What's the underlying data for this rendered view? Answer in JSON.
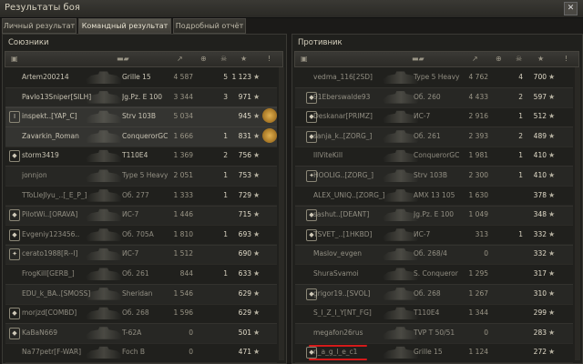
{
  "window": {
    "title": "Результаты боя"
  },
  "tabs": [
    "Личный результат",
    "Командный результат",
    "Подробный отчёт"
  ],
  "allies": {
    "title": "Союзники",
    "rows": [
      {
        "player": "Artem200214",
        "vehicle": "Grille 15",
        "damage": "4 587",
        "frags": "5",
        "xp": "1 123",
        "platoon": "",
        "dead": false,
        "medal": false
      },
      {
        "player": "Pavlo13Sniper[SILH]",
        "vehicle": "Jg.Pz. E 100",
        "damage": "3 344",
        "frags": "3",
        "xp": "971",
        "platoon": "",
        "dead": false,
        "medal": false
      },
      {
        "player": "inspekt..[YAP_C]",
        "vehicle": "Strv 103B",
        "damage": "5 034",
        "frags": "",
        "xp": "945",
        "platoon": "I",
        "dead": false,
        "medal": true
      },
      {
        "player": "Zavarkin_Roman",
        "vehicle": "ConquerorGC",
        "damage": "1 666",
        "frags": "1",
        "xp": "831",
        "platoon": "",
        "dead": false,
        "medal": true
      },
      {
        "player": "storm3419",
        "vehicle": "T110E4",
        "damage": "1 369",
        "frags": "2",
        "xp": "756",
        "platoon": "◆",
        "dead": false,
        "medal": false
      },
      {
        "player": "jonnjon",
        "vehicle": "Type 5 Heavy",
        "damage": "2 051",
        "frags": "1",
        "xp": "753",
        "platoon": "",
        "dead": true,
        "medal": false
      },
      {
        "player": "TToLleJlyu_..[_E_P_]",
        "vehicle": "Об. 277",
        "damage": "1 333",
        "frags": "1",
        "xp": "729",
        "platoon": "",
        "dead": true,
        "medal": false
      },
      {
        "player": "PilotWi..[ORAVA]",
        "vehicle": "ИС-7",
        "damage": "1 446",
        "frags": "",
        "xp": "715",
        "platoon": "◆",
        "dead": true,
        "medal": false
      },
      {
        "player": "Evgeniy123456..",
        "vehicle": "Об. 705A",
        "damage": "1 810",
        "frags": "1",
        "xp": "693",
        "platoon": "◆",
        "dead": true,
        "medal": false
      },
      {
        "player": "cerato1988[R--I]",
        "vehicle": "ИС-7",
        "damage": "1 512",
        "frags": "",
        "xp": "690",
        "platoon": "✦",
        "dead": true,
        "medal": false
      },
      {
        "player": "FrogKill[GERB_]",
        "vehicle": "Об. 261",
        "damage": "844",
        "frags": "1",
        "xp": "633",
        "platoon": "",
        "dead": true,
        "medal": false
      },
      {
        "player": "EDU_k_BA..[SMOSS]",
        "vehicle": "Sheridan",
        "damage": "1 546",
        "frags": "",
        "xp": "629",
        "platoon": "",
        "dead": true,
        "medal": false
      },
      {
        "player": "morjzd[COMBD]",
        "vehicle": "Об. 268",
        "damage": "1 596",
        "frags": "",
        "xp": "629",
        "platoon": "◆",
        "dead": true,
        "medal": false
      },
      {
        "player": "KaBaN669",
        "vehicle": "T-62A",
        "damage": "0",
        "frags": "",
        "xp": "501",
        "platoon": "◆",
        "dead": true,
        "medal": false
      },
      {
        "player": "Na77petr[F-WAR]",
        "vehicle": "Foch B",
        "damage": "0",
        "frags": "",
        "xp": "471",
        "platoon": "",
        "dead": true,
        "medal": false
      }
    ]
  },
  "enemies": {
    "title": "Противник",
    "rows": [
      {
        "player": "vedma_116[2SD]",
        "vehicle": "Type 5 Heavy",
        "damage": "4 762",
        "frags": "4",
        "xp": "700",
        "platoon": "",
        "dead": true
      },
      {
        "player": "91Eberswalde93",
        "vehicle": "Об. 260",
        "damage": "4 433",
        "frags": "2",
        "xp": "597",
        "platoon": "◆",
        "dead": true
      },
      {
        "player": "Deskanar[PRIMZ]",
        "vehicle": "ИС-7",
        "damage": "2 916",
        "frags": "1",
        "xp": "512",
        "platoon": "◆",
        "dead": true
      },
      {
        "player": "sanja_k..[ZORG_]",
        "vehicle": "Об. 261",
        "damage": "2 393",
        "frags": "2",
        "xp": "489",
        "platoon": "◆",
        "dead": true
      },
      {
        "player": "lllViteKill",
        "vehicle": "ConquerorGC",
        "damage": "1 981",
        "frags": "1",
        "xp": "410",
        "platoon": "",
        "dead": true
      },
      {
        "player": "HOOLIG..[ZORG_]",
        "vehicle": "Strv 103B",
        "damage": "2 300",
        "frags": "1",
        "xp": "410",
        "platoon": "✦",
        "dead": true
      },
      {
        "player": "ALEX_UNIQ..[ZORG_]",
        "vehicle": "AMX 13 105",
        "damage": "1 630",
        "frags": "",
        "xp": "378",
        "platoon": "",
        "dead": true
      },
      {
        "player": "sashut..[DEANT]",
        "vehicle": "Jg.Pz. E 100",
        "damage": "1 049",
        "frags": "",
        "xp": "348",
        "platoon": "◆",
        "dead": true
      },
      {
        "player": "TSVET_..[1HKBD]",
        "vehicle": "ИС-7",
        "damage": "313",
        "frags": "1",
        "xp": "332",
        "platoon": "◆",
        "dead": true
      },
      {
        "player": "Maslov_evgen",
        "vehicle": "Об. 268/4",
        "damage": "0",
        "frags": "",
        "xp": "332",
        "platoon": "",
        "dead": true
      },
      {
        "player": "ShuraSvamoi",
        "vehicle": "S. Conqueror",
        "damage": "1 295",
        "frags": "",
        "xp": "317",
        "platoon": "",
        "dead": true
      },
      {
        "player": "grigor19..[SVOL]",
        "vehicle": "Об. 268",
        "damage": "1 267",
        "frags": "",
        "xp": "310",
        "platoon": "◆",
        "dead": true
      },
      {
        "player": "S_I_Z_I_Y[NT_FG]",
        "vehicle": "T110E4",
        "damage": "1 344",
        "frags": "",
        "xp": "299",
        "platoon": "",
        "dead": true
      },
      {
        "player": "megafon26rus",
        "vehicle": "TVP T 50/51",
        "damage": "0",
        "frags": "",
        "xp": "283",
        "platoon": "",
        "dead": true
      },
      {
        "player": "n_a_g_l_e_c1",
        "vehicle": "Grille 15",
        "damage": "1 124",
        "frags": "",
        "xp": "272",
        "platoon": "◆",
        "dead": true
      }
    ]
  },
  "colors": {
    "highlight_line": "#d41a1a",
    "accent": "#e0b050"
  }
}
